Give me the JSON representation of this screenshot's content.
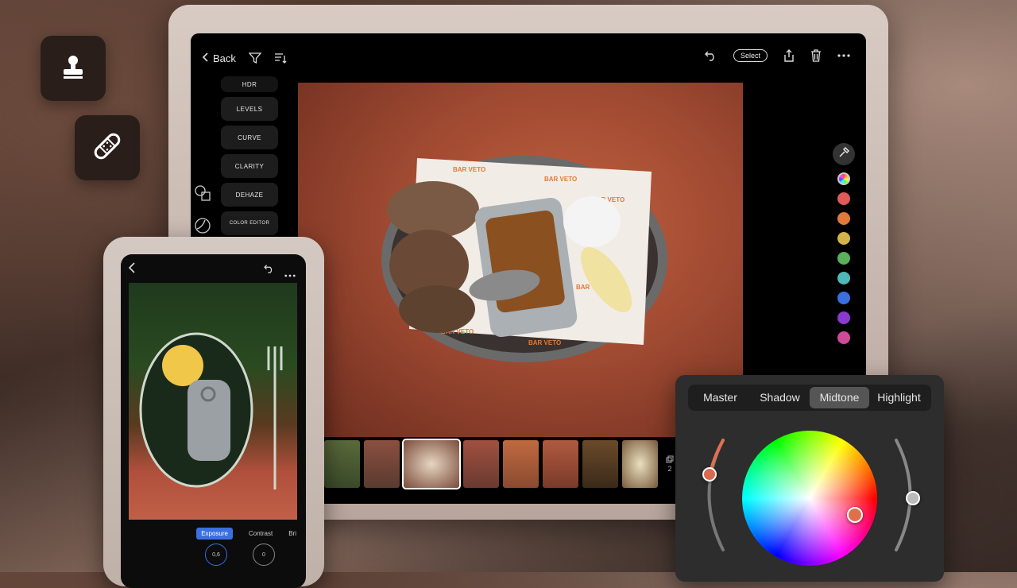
{
  "floating_tools": {
    "stamp_icon": "stamp-icon",
    "bandage_icon": "bandage-icon"
  },
  "tablet": {
    "topbar": {
      "back_label": "Back",
      "select_label": "Select"
    },
    "tools": [
      "HDR",
      "LEVELS",
      "CURVE",
      "CLARITY",
      "DEHAZE",
      "COLOR EDITOR"
    ],
    "color_swatches": [
      "#ff6b6b",
      "#e07a3a",
      "#d4b44a",
      "#5bc05b",
      "#4fc0c0",
      "#3a6fe0",
      "#8a3ad0",
      "#d04a9a"
    ],
    "filmstrip_stack_count": "2",
    "photo_wrapper_text": "BAR VETO"
  },
  "phone": {
    "adjust_tabs": [
      "Exposure",
      "Contrast",
      "Bri"
    ],
    "dial_values": [
      "0,6",
      "0"
    ]
  },
  "grade_panel": {
    "tabs": [
      "Master",
      "Shadow",
      "Midtone",
      "Highlight"
    ],
    "active_tab": "Midtone"
  }
}
